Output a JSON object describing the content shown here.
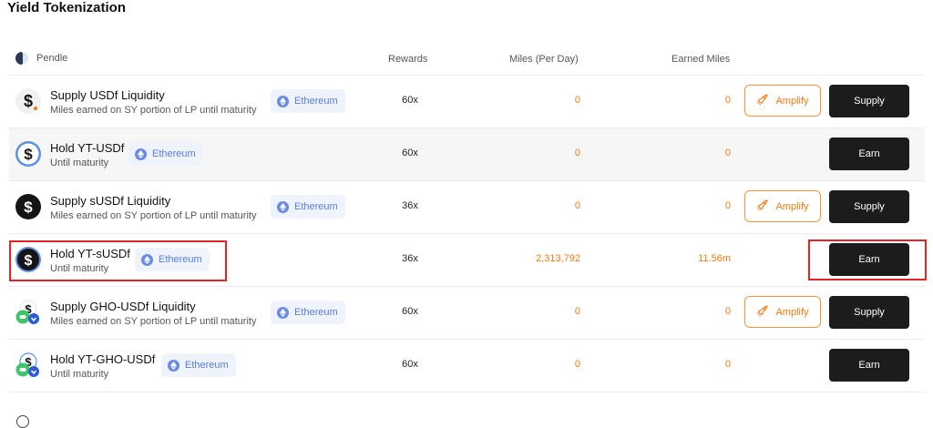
{
  "page": {
    "title": "Yield Tokenization"
  },
  "header": {
    "protocol": "Pendle",
    "rewards": "Rewards",
    "miles_per_day": "Miles (Per Day)",
    "earned_miles": "Earned Miles"
  },
  "rows": [
    {
      "name": "Supply USDf Liquidity",
      "sub": "Miles earned on SY portion of LP until maturity",
      "chain": "Ethereum",
      "rewards": "60x",
      "miles": "0",
      "earned": "0",
      "amplify": "Amplify",
      "action": "Supply",
      "icon": "usdf-icon"
    },
    {
      "name": "Hold YT-USDf",
      "sub": "Until maturity",
      "chain": "Ethereum",
      "rewards": "60x",
      "miles": "0",
      "earned": "0",
      "action": "Earn",
      "icon": "yt-usdf-icon"
    },
    {
      "name": "Supply sUSDf Liquidity",
      "sub": "Miles earned on SY portion of LP until maturity",
      "chain": "Ethereum",
      "rewards": "36x",
      "miles": "0",
      "earned": "0",
      "amplify": "Amplify",
      "action": "Supply",
      "icon": "susdf-icon"
    },
    {
      "name": "Hold YT-sUSDf",
      "sub": "Until maturity",
      "chain": "Ethereum",
      "rewards": "36x",
      "miles": "2,313,792",
      "earned": "11.56m",
      "action": "Earn",
      "icon": "yt-susdf-icon"
    },
    {
      "name": "Supply GHO-USDf Liquidity",
      "sub": "Miles earned on SY portion of LP until maturity",
      "chain": "Ethereum",
      "rewards": "60x",
      "miles": "0",
      "earned": "0",
      "amplify": "Amplify",
      "action": "Supply",
      "icon": "gho-usdf-icon"
    },
    {
      "name": "Hold YT-GHO-USDf",
      "sub": "Until maturity",
      "chain": "Ethereum",
      "rewards": "60x",
      "miles": "0",
      "earned": "0",
      "action": "Earn",
      "icon": "yt-gho-usdf-icon"
    }
  ],
  "colors": {
    "accent": "#f07a14",
    "button": "#1c1c1c",
    "chip_bg": "#eef3fc",
    "chip_text": "#5b7fd8",
    "highlight": "#e0242a"
  }
}
